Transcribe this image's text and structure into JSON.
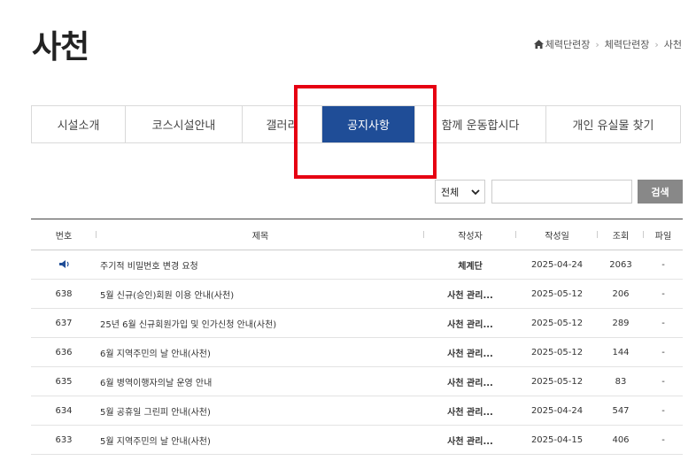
{
  "page": {
    "title": "사천"
  },
  "breadcrumb": {
    "items": [
      "체력단련장",
      "체력단련장",
      "사천"
    ]
  },
  "tabs": [
    {
      "label": "시설소개"
    },
    {
      "label": "코스시설안내"
    },
    {
      "label": "갤러리"
    },
    {
      "label": "공지사항"
    },
    {
      "label": "함께 운동합시다"
    },
    {
      "label": "개인 유실물 찾기"
    }
  ],
  "active_tab": "공지사항",
  "search": {
    "select_value": "전체",
    "input_value": "",
    "button_label": "검색"
  },
  "board": {
    "columns": [
      "번호",
      "제목",
      "작성자",
      "작성일",
      "조회",
      "파일"
    ],
    "rows": [
      {
        "num": "",
        "notice": true,
        "title": "주기적 비밀번호 변경 요청",
        "writer": "체계단",
        "date": "2025-04-24",
        "views": "2063",
        "file": "-"
      },
      {
        "num": "638",
        "title": "5월 신규(승인)회원 이용 안내(사천)",
        "writer": "사천 관리...",
        "date": "2025-05-12",
        "views": "206",
        "file": "-"
      },
      {
        "num": "637",
        "title": "25년 6월 신규회원가입 및 인가신청 안내(사천)",
        "writer": "사천 관리...",
        "date": "2025-05-12",
        "views": "289",
        "file": "-"
      },
      {
        "num": "636",
        "title": "6월 지역주민의 날 안내(사천)",
        "writer": "사천 관리...",
        "date": "2025-05-12",
        "views": "144",
        "file": "-"
      },
      {
        "num": "635",
        "title": "6월 병역이행자의날 운영 안내",
        "writer": "사천 관리...",
        "date": "2025-05-12",
        "views": "83",
        "file": "-"
      },
      {
        "num": "634",
        "title": "5월 공휴일 그린피 안내(사천)",
        "writer": "사천 관리...",
        "date": "2025-04-24",
        "views": "547",
        "file": "-"
      },
      {
        "num": "633",
        "title": "5월 지역주민의 날 안내(사천)",
        "writer": "사천 관리...",
        "date": "2025-04-15",
        "views": "406",
        "file": "-"
      }
    ]
  },
  "colors": {
    "active_tab": "#1f4d97",
    "highlight": "#e60012",
    "search_button": "#888888"
  }
}
